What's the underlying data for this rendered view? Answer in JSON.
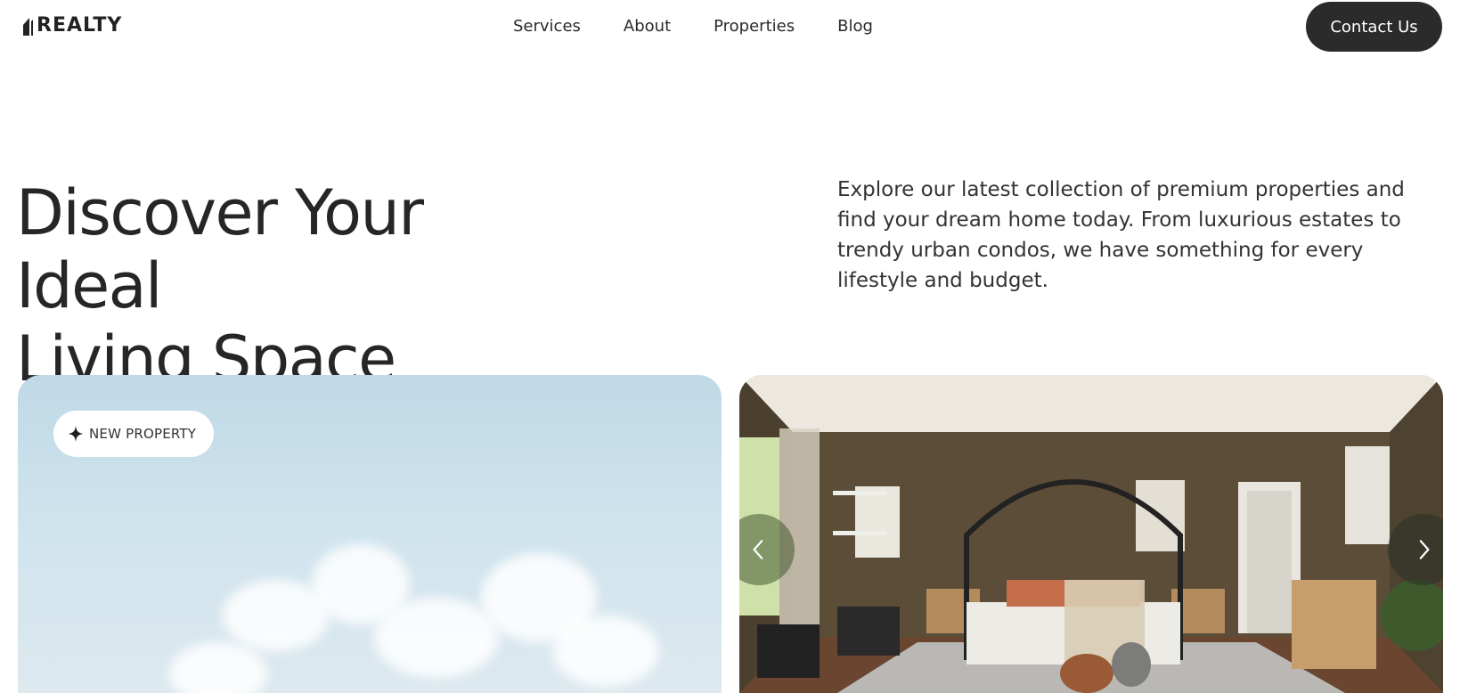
{
  "brand": {
    "name": "REALTY"
  },
  "nav": {
    "items": [
      {
        "label": "Services"
      },
      {
        "label": "About"
      },
      {
        "label": "Properties"
      },
      {
        "label": "Blog"
      }
    ],
    "contact_label": "Contact Us"
  },
  "hero": {
    "title_line1": "Discover Your Ideal",
    "title_line2": "Living Space",
    "description": "Explore our latest collection of premium properties and find your dream home today. From luxurious estates to trendy urban condos, we have something for every lifestyle and budget."
  },
  "cards": {
    "badge_label": "NEW PROPERTY",
    "badge_icon": "sparkle-icon",
    "prev_icon": "chevron-left-icon",
    "next_icon": "chevron-right-icon"
  },
  "colors": {
    "text": "#1f1f1f",
    "button_bg": "#2b2b2b",
    "button_text": "#ffffff",
    "sky": "#cfe3ed"
  }
}
